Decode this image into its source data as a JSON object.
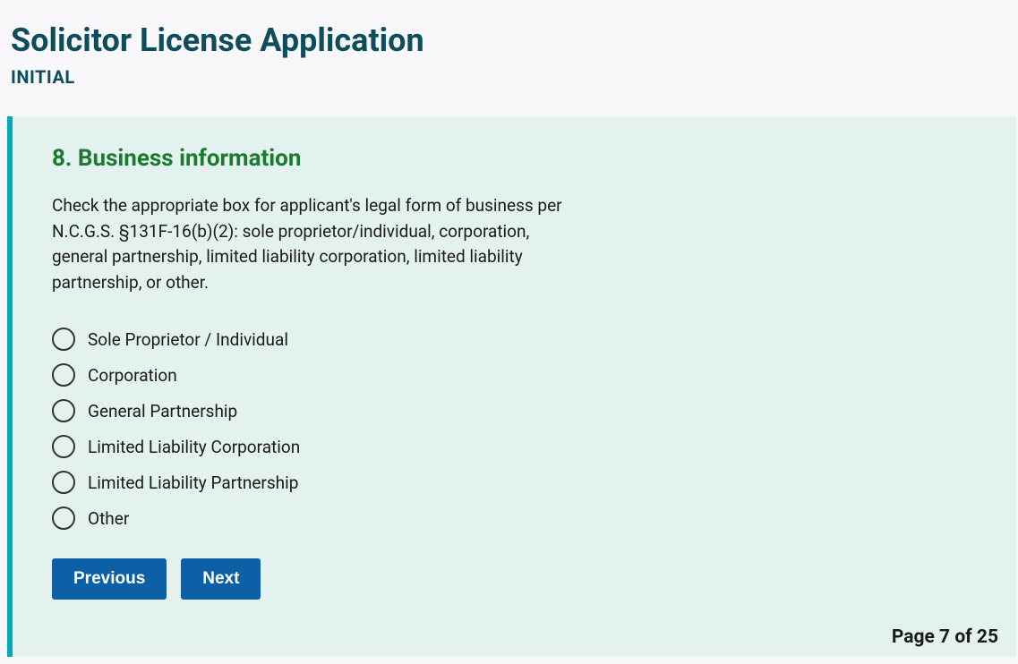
{
  "header": {
    "title": "Solicitor License Application",
    "subtitle": "INITIAL"
  },
  "section": {
    "heading": "8. Business information",
    "description": "Check the appropriate box for applicant's legal form of business per N.C.G.S. §131F-16(b)(2): sole proprietor/individual, corporation, general partnership, limited liability corporation, limited liability partnership, or other."
  },
  "options": [
    "Sole Proprietor / Individual",
    "Corporation",
    "General Partnership",
    "Limited Liability Corporation",
    "Limited Liability Partnership",
    "Other"
  ],
  "buttons": {
    "previous": "Previous",
    "next": "Next"
  },
  "pagination": {
    "text": "Page 7 of 25"
  }
}
